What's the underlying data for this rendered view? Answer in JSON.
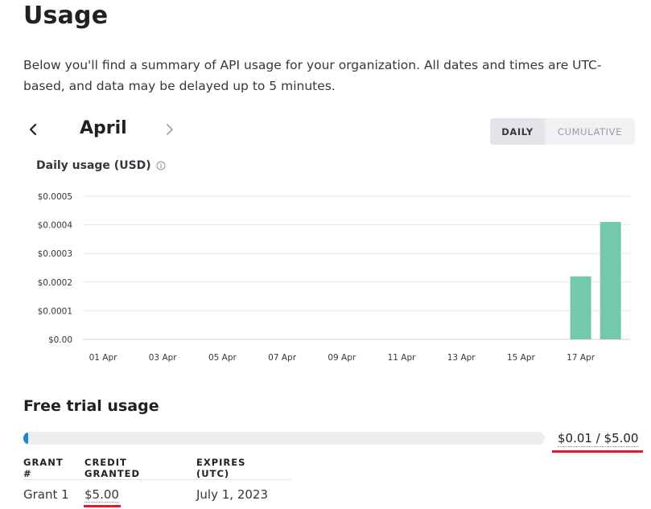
{
  "page": {
    "title": "Usage",
    "description": "Below you'll find a summary of API usage for your organization. All dates and times are UTC-based, and data may be delayed up to 5 minutes."
  },
  "month_nav": {
    "month": "April",
    "prev_icon": "chevron-left-icon",
    "next_icon": "chevron-right-icon"
  },
  "view_toggle": {
    "daily": "DAILY",
    "cumulative": "CUMULATIVE",
    "selected": "DAILY"
  },
  "chart_data": {
    "type": "bar",
    "title": "Daily usage (USD)",
    "info_icon": "info-icon",
    "x_tick_labels": [
      "01 Apr",
      "03 Apr",
      "05 Apr",
      "07 Apr",
      "09 Apr",
      "11 Apr",
      "13 Apr",
      "15 Apr",
      "17 Apr"
    ],
    "y_tick_labels": [
      "$0.0005",
      "$0.0004",
      "$0.0003",
      "$0.0002",
      "$0.0001",
      "$0.00"
    ],
    "categories": [
      "01 Apr",
      "02 Apr",
      "03 Apr",
      "04 Apr",
      "05 Apr",
      "06 Apr",
      "07 Apr",
      "08 Apr",
      "09 Apr",
      "10 Apr",
      "11 Apr",
      "12 Apr",
      "13 Apr",
      "14 Apr",
      "15 Apr",
      "16 Apr",
      "17 Apr",
      "18 Apr"
    ],
    "values": [
      0,
      0,
      0,
      0,
      0,
      0,
      0,
      0,
      0,
      0,
      0,
      0,
      0,
      0,
      0,
      0,
      0.00022,
      0.00041
    ],
    "ylim": [
      0,
      0.0005
    ],
    "grid": true,
    "bar_color": "#74c8ad"
  },
  "free_trial": {
    "title": "Free trial usage",
    "used_fraction": 0.002,
    "amount": "$0.01 / $5.00",
    "bar_color": "#1f86cf",
    "track_color": "#ececf1"
  },
  "grants_table": {
    "headers": [
      "GRANT #",
      "CREDIT GRANTED",
      "EXPIRES (UTC)"
    ],
    "rows": [
      [
        "Grant 1",
        "$5.00",
        "July 1, 2023"
      ]
    ]
  },
  "annotation_color": "#e8192c"
}
